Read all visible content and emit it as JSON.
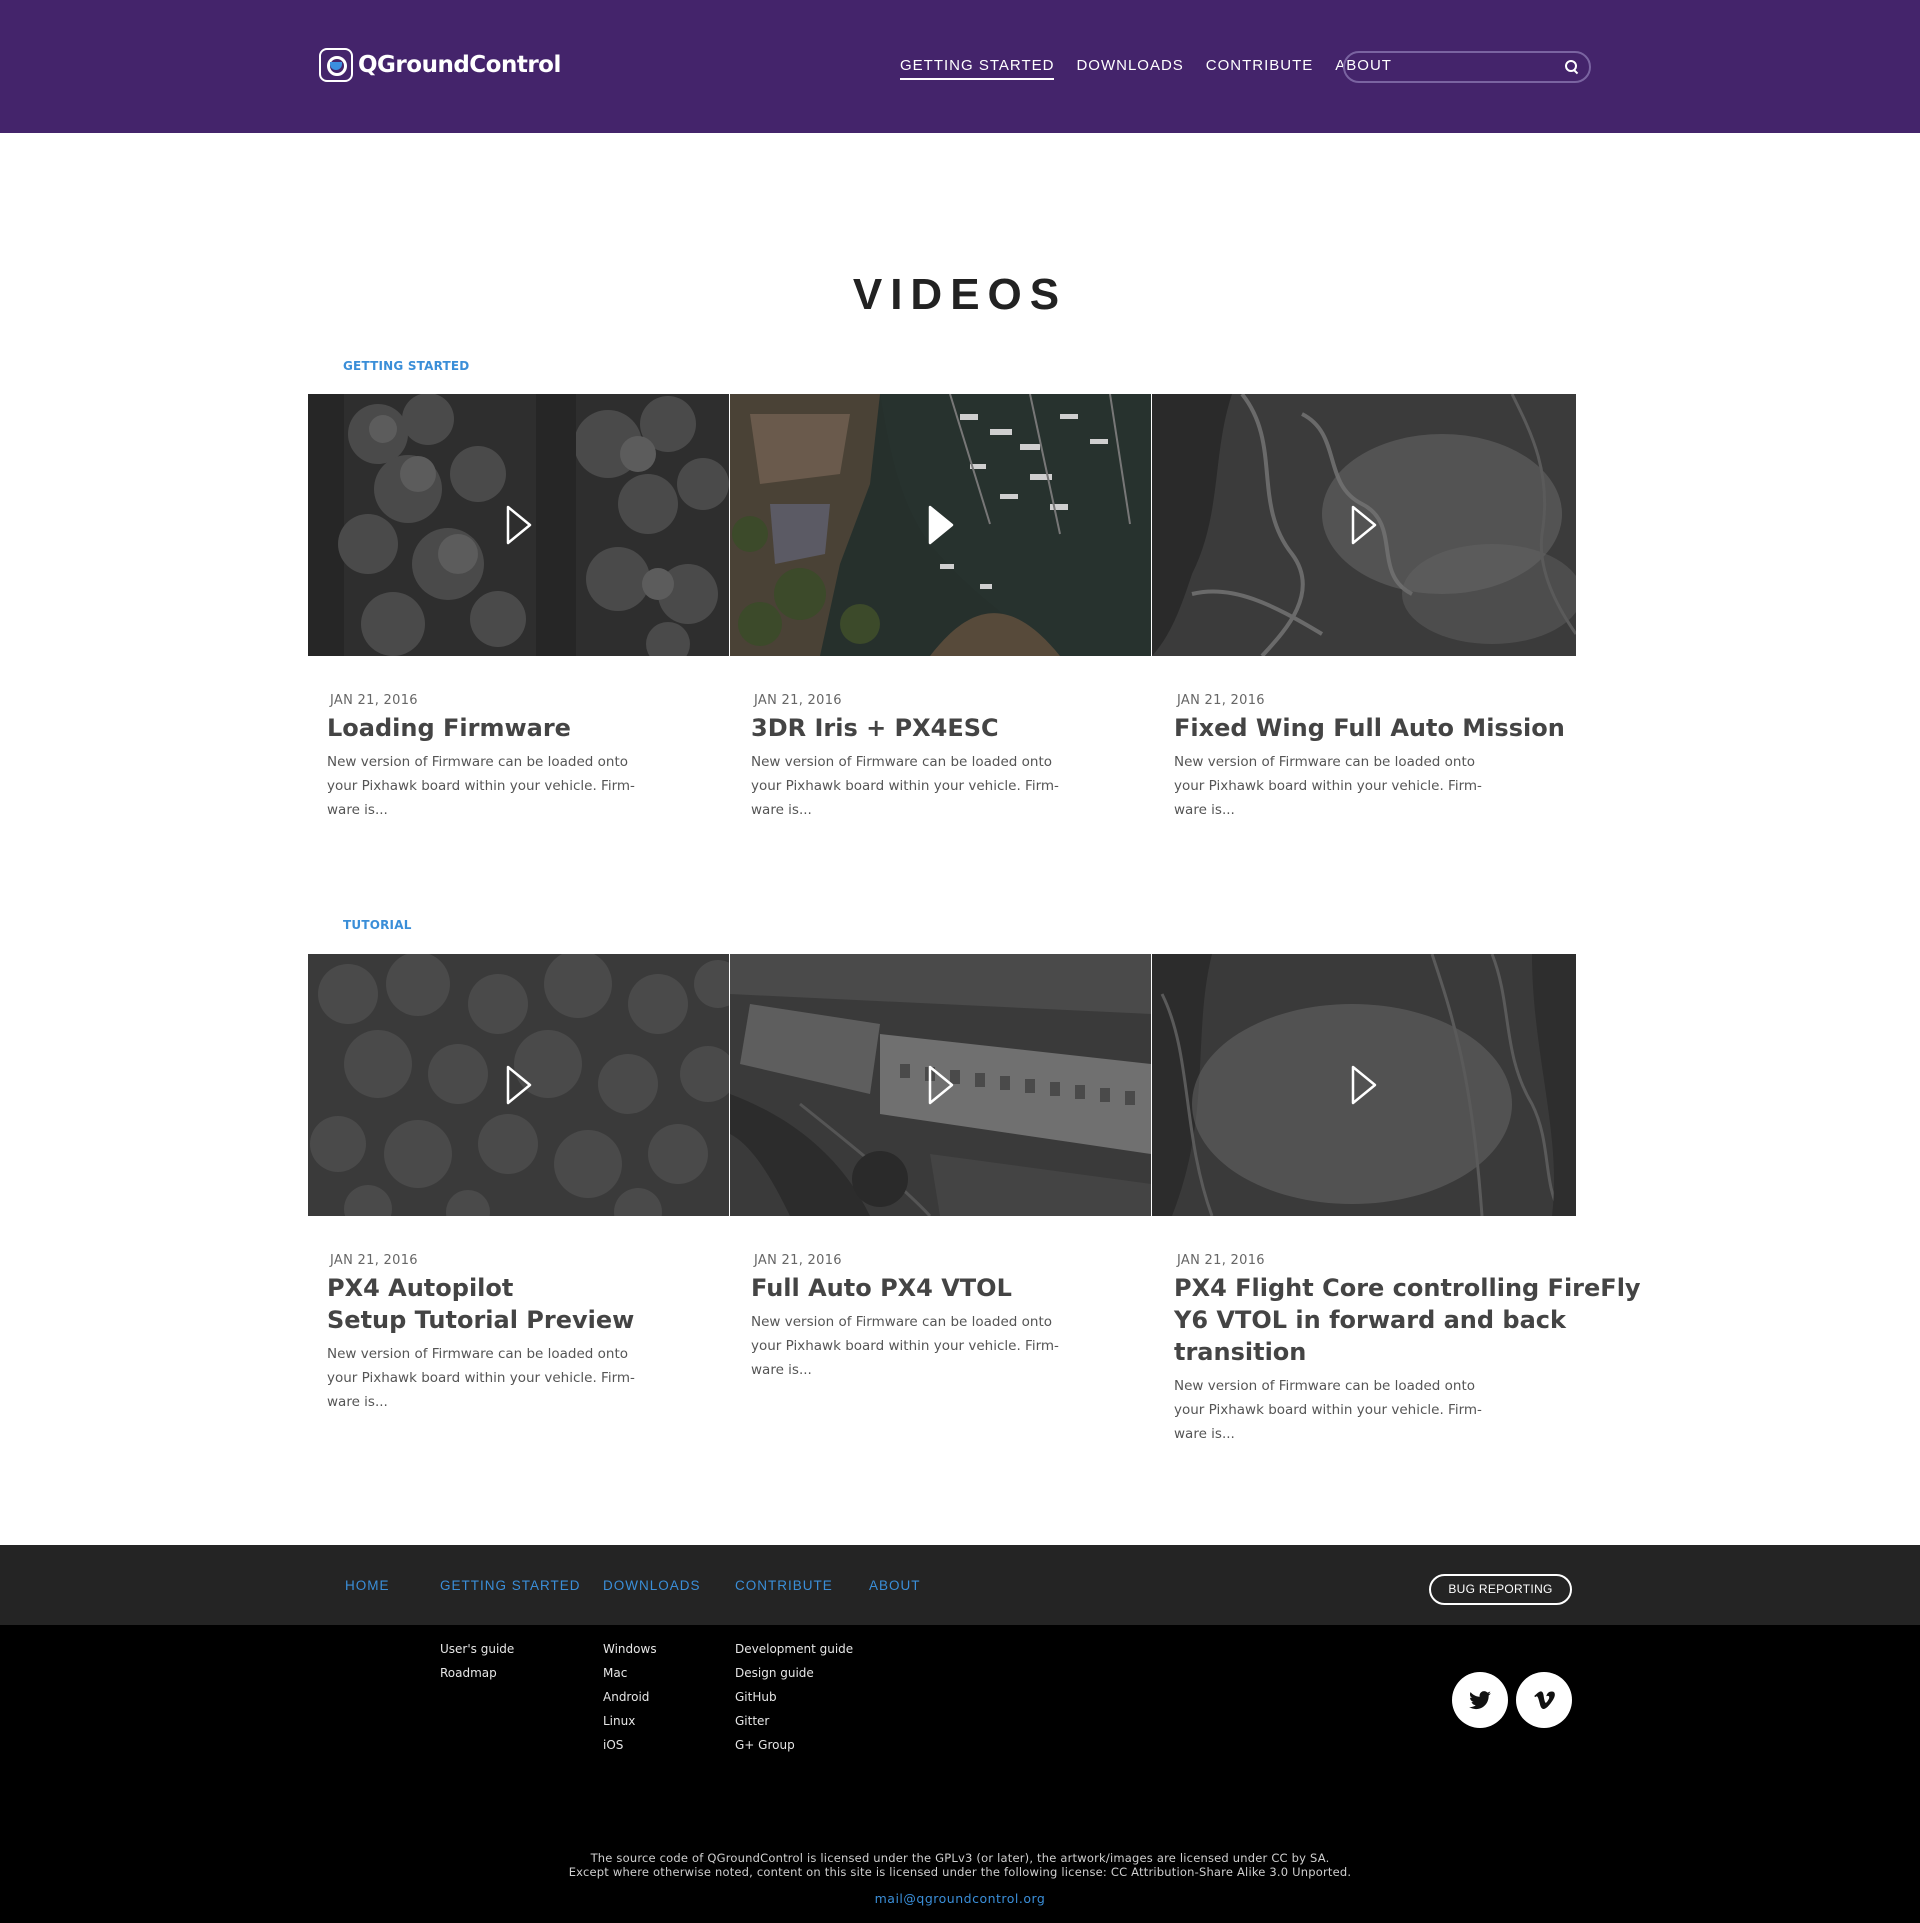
{
  "header": {
    "logo_text": "QGroundControl",
    "nav": [
      "GETTING STARTED",
      "DOWNLOADS",
      "CONTRIBUTE",
      "ABOUT"
    ],
    "search_placeholder": ""
  },
  "main": {
    "title": "VIDEOS",
    "sections": [
      {
        "label": "GETTING STARTED",
        "videos": [
          {
            "date": "JAN 21, 2016",
            "title": "Loading Firmware",
            "desc": "New version of Firmware can be loaded onto your Pixhawk board within your vehicle. Firm-ware is..."
          },
          {
            "date": "JAN 21, 2016",
            "title": "3DR Iris + PX4ESC",
            "desc": "New version of Firmware can be loaded onto your Pixhawk board within your vehicle. Firm-ware is..."
          },
          {
            "date": "JAN 21, 2016",
            "title": "Fixed Wing Full Auto Mission",
            "desc": "New version of Firmware can be loaded onto your Pixhawk board within your vehicle. Firm-ware is..."
          }
        ]
      },
      {
        "label": "TUTORIAL",
        "videos": [
          {
            "date": "JAN 21, 2016",
            "title_line1": "PX4 Autopilot",
            "title_line2": "Setup Tutorial Preview",
            "desc": "New version of Firmware can be loaded onto your Pixhawk board within your vehicle. Firm-ware is..."
          },
          {
            "date": "JAN 21, 2016",
            "title": "Full Auto PX4 VTOL",
            "desc": "New version of Firmware can be loaded onto your Pixhawk board within your vehicle. Firm-ware is..."
          },
          {
            "date": "JAN 21, 2016",
            "title_line1": "PX4 Flight Core controlling FireFly",
            "title_line2": "Y6 VTOL in forward and back transition",
            "desc": "New version of Firmware can be loaded onto your Pixhawk board within your vehicle. Firm-ware is..."
          }
        ]
      }
    ]
  },
  "footer": {
    "nav": [
      "HOME",
      "GETTING STARTED",
      "DOWNLOADS",
      "CONTRIBUTE",
      "ABOUT"
    ],
    "bug_button": "BUG REPORTING",
    "getting_started_links": [
      "User's guide",
      "Roadmap"
    ],
    "downloads_links": [
      "Windows",
      "Mac",
      "Android",
      "Linux",
      "iOS"
    ],
    "contribute_links": [
      "Development guide",
      "Design guide",
      "GitHub",
      "Gitter",
      "G+ Group"
    ],
    "social": [
      "twitter-icon",
      "vimeo-icon"
    ],
    "license_line1": "The source code of QGroundControl is licensed under the GPLv3 (or later), the artwork/images are licensed under CC by SA.",
    "license_line2": "Except where otherwise noted, content on this site is licensed under the following license: CC Attribution-Share Alike 3.0 Unported.",
    "email": "mail@qgroundcontrol.org"
  },
  "colors": {
    "header_bg": "#44246b",
    "accent": "#3a8ed8",
    "footer_nav_bg": "#242424",
    "footer_bg": "#000000"
  }
}
